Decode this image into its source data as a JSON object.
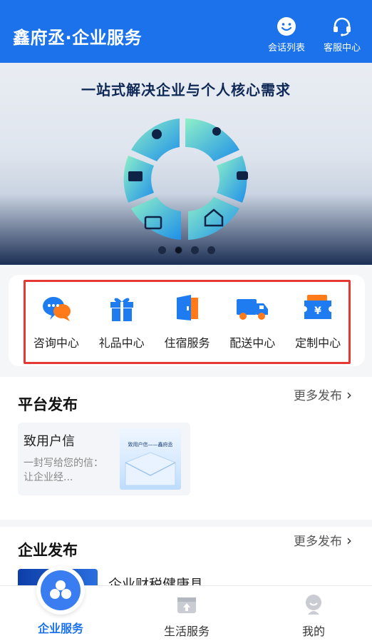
{
  "header": {
    "title": "鑫府丞·企业服务",
    "chat_label": "会话列表",
    "service_label": "客服中心"
  },
  "banner": {
    "title": "一站式解决企业与个人核心需求",
    "slides": 4,
    "active_slide": 2
  },
  "services": [
    {
      "label": "咨询中心",
      "icon": "chat-bubble-icon"
    },
    {
      "label": "礼品中心",
      "icon": "gift-icon"
    },
    {
      "label": "住宿服务",
      "icon": "door-icon"
    },
    {
      "label": "配送中心",
      "icon": "truck-icon"
    },
    {
      "label": "定制中心",
      "icon": "ticket-yen-icon"
    }
  ],
  "platform": {
    "title": "平台发布",
    "more": "更多发布",
    "card_title": "致用户信",
    "card_desc": "一封写给您的信：让企业经...",
    "thumb_caption": "致用户信——鑫府丞"
  },
  "enterprise": {
    "title": "企业发布",
    "more": "更多发布",
    "card_title": "企业财税健康县"
  },
  "tabs": [
    {
      "label": "企业服务",
      "active": true
    },
    {
      "label": "生活服务",
      "active": false
    },
    {
      "label": "我的",
      "active": false
    }
  ],
  "colors": {
    "primary": "#1b72ea",
    "highlight_border": "#e53935",
    "icon_blue": "#1f7cf0",
    "icon_orange": "#ff7a1a"
  }
}
